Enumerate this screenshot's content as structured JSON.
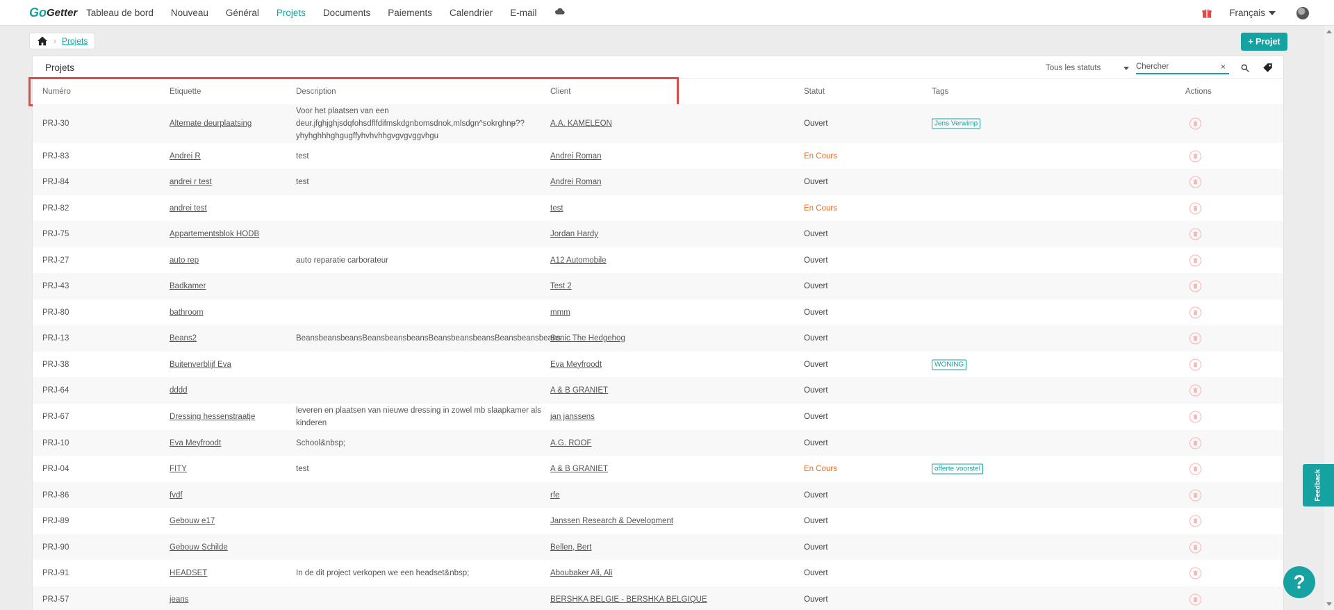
{
  "nav": {
    "logo_top": "Go",
    "logo_bottom": "Getter",
    "items": [
      {
        "label": "Tableau de bord"
      },
      {
        "label": "Nouveau"
      },
      {
        "label": "Général"
      },
      {
        "label": "Projets"
      },
      {
        "label": "Documents"
      },
      {
        "label": "Paiements"
      },
      {
        "label": "Calendrier"
      },
      {
        "label": "E-mail"
      }
    ],
    "active": "Projets",
    "language": "Français"
  },
  "breadcrumb": {
    "current": "Projets"
  },
  "add_button": "+ Projet",
  "card": {
    "title": "Projets",
    "status_filter": "Tous les statuts",
    "search_placeholder": "Chercher",
    "clear": "×"
  },
  "table": {
    "headers": {
      "number": "Numéro",
      "label": "Etiquette",
      "description": "Description",
      "client": "Client",
      "status": "Statut",
      "tags": "Tags",
      "actions": "Actions"
    },
    "rows": [
      {
        "number": "PRJ-30",
        "label": "Alternate deurplaatsing",
        "description": "Voor het plaatsen van een deur.jfghjghjsdqfohsdflfdifmskdgnbomsdnok,mlsdgn^sokrghnᵽ?? yhyhghhhghgugffyhvhvhhgvgvgvggvhgu",
        "client": "A.A. KAMELEON",
        "status": "Ouvert",
        "tag": "Jens Verwimp"
      },
      {
        "number": "PRJ-83",
        "label": "Andrei R",
        "description": "test",
        "client": "Andrei Roman",
        "status": "En Cours",
        "tag": ""
      },
      {
        "number": "PRJ-84",
        "label": "andrei r test",
        "description": "test",
        "client": "Andrei Roman",
        "status": "Ouvert",
        "tag": ""
      },
      {
        "number": "PRJ-82",
        "label": "andrei test",
        "description": "",
        "client": "test",
        "status": "En Cours",
        "tag": ""
      },
      {
        "number": "PRJ-75",
        "label": "Appartementsblok HODB",
        "description": "",
        "client": "Jordan Hardy",
        "status": "Ouvert",
        "tag": ""
      },
      {
        "number": "PRJ-27",
        "label": "auto rep",
        "description": "auto reparatie carborateur",
        "client": "A12 Automobile",
        "status": "Ouvert",
        "tag": ""
      },
      {
        "number": "PRJ-43",
        "label": "Badkamer",
        "description": "",
        "client": "Test 2",
        "status": "Ouvert",
        "tag": ""
      },
      {
        "number": "PRJ-80",
        "label": "bathroom",
        "description": "",
        "client": "mmm",
        "status": "Ouvert",
        "tag": ""
      },
      {
        "number": "PRJ-13",
        "label": "Beans2",
        "description": "BeansbeansbeansBeansbeansbeansBeansbeansbeansBeansbeansbeans",
        "client": "Sonic The Hedgehog",
        "status": "Ouvert",
        "tag": ""
      },
      {
        "number": "PRJ-38",
        "label": "Buitenverblijf Eva",
        "description": "",
        "client": "Eva Meyfroodt",
        "status": "Ouvert",
        "tag": "WONING"
      },
      {
        "number": "PRJ-64",
        "label": "dddd",
        "description": "",
        "client": "A & B GRANIET",
        "status": "Ouvert",
        "tag": ""
      },
      {
        "number": "PRJ-67",
        "label": "Dressing hessenstraatje",
        "description": "leveren en plaatsen van nieuwe dressing in zowel mb slaapkamer als kinderen",
        "client": "jan janssens",
        "status": "Ouvert",
        "tag": ""
      },
      {
        "number": "PRJ-10",
        "label": "Eva Meyfroodt",
        "description": "School&nbsp;",
        "client": "A.G. ROOF",
        "status": "Ouvert",
        "tag": ""
      },
      {
        "number": "PRJ-04",
        "label": "FITY",
        "description": "test",
        "client": "A & B GRANIET",
        "status": "En Cours",
        "tag": "offerte voorstel"
      },
      {
        "number": "PRJ-86",
        "label": "fvdf",
        "description": "",
        "client": "rfe",
        "status": "Ouvert",
        "tag": ""
      },
      {
        "number": "PRJ-89",
        "label": "Gebouw e17",
        "description": "",
        "client": "Janssen Research & Development",
        "status": "Ouvert",
        "tag": ""
      },
      {
        "number": "PRJ-90",
        "label": "Gebouw Schilde",
        "description": "",
        "client": "Bellen, Bert",
        "status": "Ouvert",
        "tag": ""
      },
      {
        "number": "PRJ-91",
        "label": "HEADSET",
        "description": "In de dit project verkopen we een headset&nbsp;",
        "client": "Aboubaker Ali, Ali",
        "status": "Ouvert",
        "tag": ""
      },
      {
        "number": "PRJ-57",
        "label": "jeans",
        "description": "",
        "client": "BERSHKA BELGIE - BERSHKA BELGIQUE",
        "status": "Ouvert",
        "tag": ""
      }
    ]
  },
  "feedback": "Feedback",
  "help": "?",
  "colors": {
    "accent": "#17a2a2",
    "in_progress": "#f06a22",
    "highlight": "#e14848",
    "delete": "#f4b4b4"
  }
}
